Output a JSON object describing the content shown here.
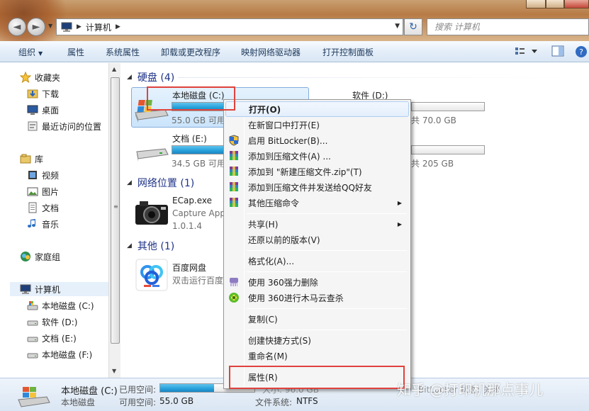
{
  "toolbar_nav": {
    "address_crumbs": [
      "计算机"
    ],
    "search_placeholder": "搜索 计算机"
  },
  "command_bar": {
    "organize": "组织",
    "properties": "属性",
    "system_properties": "系统属性",
    "uninstall": "卸载或更改程序",
    "map_drive": "映射网络驱动器",
    "control_panel": "打开控制面板"
  },
  "nav_pane": {
    "favorites": "收藏夹",
    "downloads": "下载",
    "desktop": "桌面",
    "recent": "最近访问的位置",
    "libraries": "库",
    "videos": "视频",
    "pictures": "图片",
    "documents": "文档",
    "music": "音乐",
    "homegroup": "家庭组",
    "computer": "计算机",
    "drive_c": "本地磁盘 (C:)",
    "drive_d": "软件 (D:)",
    "drive_e": "文档 (E:)",
    "drive_f": "本地磁盘 (F:)"
  },
  "content": {
    "hdd_group": "硬盘 (4)",
    "net_group": "网络位置 (1)",
    "other_group": "其他 (1)",
    "drives": [
      {
        "name": "本地磁盘 (C:)",
        "free": "55.0 GB 可用",
        "used_fraction": 0.52
      },
      {
        "name": "软件 (D:)",
        "free": "共 70.0 GB",
        "used_fraction": 0.0
      },
      {
        "name": "文档 (E:)",
        "free": "34.5 GB 可用",
        "used_fraction": 0.55
      },
      {
        "name": "",
        "free": "共 205 GB",
        "used_fraction": 0.0
      }
    ],
    "ecap": {
      "name": "ECap.exe",
      "desc": "Capture App",
      "version": "1.0.1.4"
    },
    "baidu": {
      "name": "百度网盘",
      "desc": "双击运行百度"
    }
  },
  "context_menu": {
    "open": "打开(O)",
    "open_new_window": "在新窗口中打开(E)",
    "bitlocker": "启用 BitLocker(B)...",
    "add_archive": "添加到压缩文件(A) ...",
    "add_zip": "添加到 \"新建压缩文件.zip\"(T)",
    "add_qq": "添加到压缩文件并发送给QQ好友",
    "other_compress": "其他压缩命令",
    "share": "共享(H)",
    "restore": "还原以前的版本(V)",
    "format": "格式化(A)...",
    "force_delete": "使用 360强力删除",
    "trojan_scan": "使用 360进行木马云查杀",
    "copy": "复制(C)",
    "shortcut": "创建快捷方式(S)",
    "rename": "重命名(M)",
    "properties": "属性(R)"
  },
  "details_pane": {
    "drive_name": "本地磁盘 (C:)",
    "drive_type": "本地磁盘",
    "used_label": "已用空间:",
    "free_label": "可用空间:",
    "free_value": "55.0 GB",
    "total_text": "大小: 96.0 GB",
    "fs_label": "文件系统:",
    "fs_value": "NTFS",
    "bitlocker_text": "BitLocker 状态: 关闭",
    "used_fraction": 0.57
  },
  "watermark": "知乎 @打印机那点事儿"
}
